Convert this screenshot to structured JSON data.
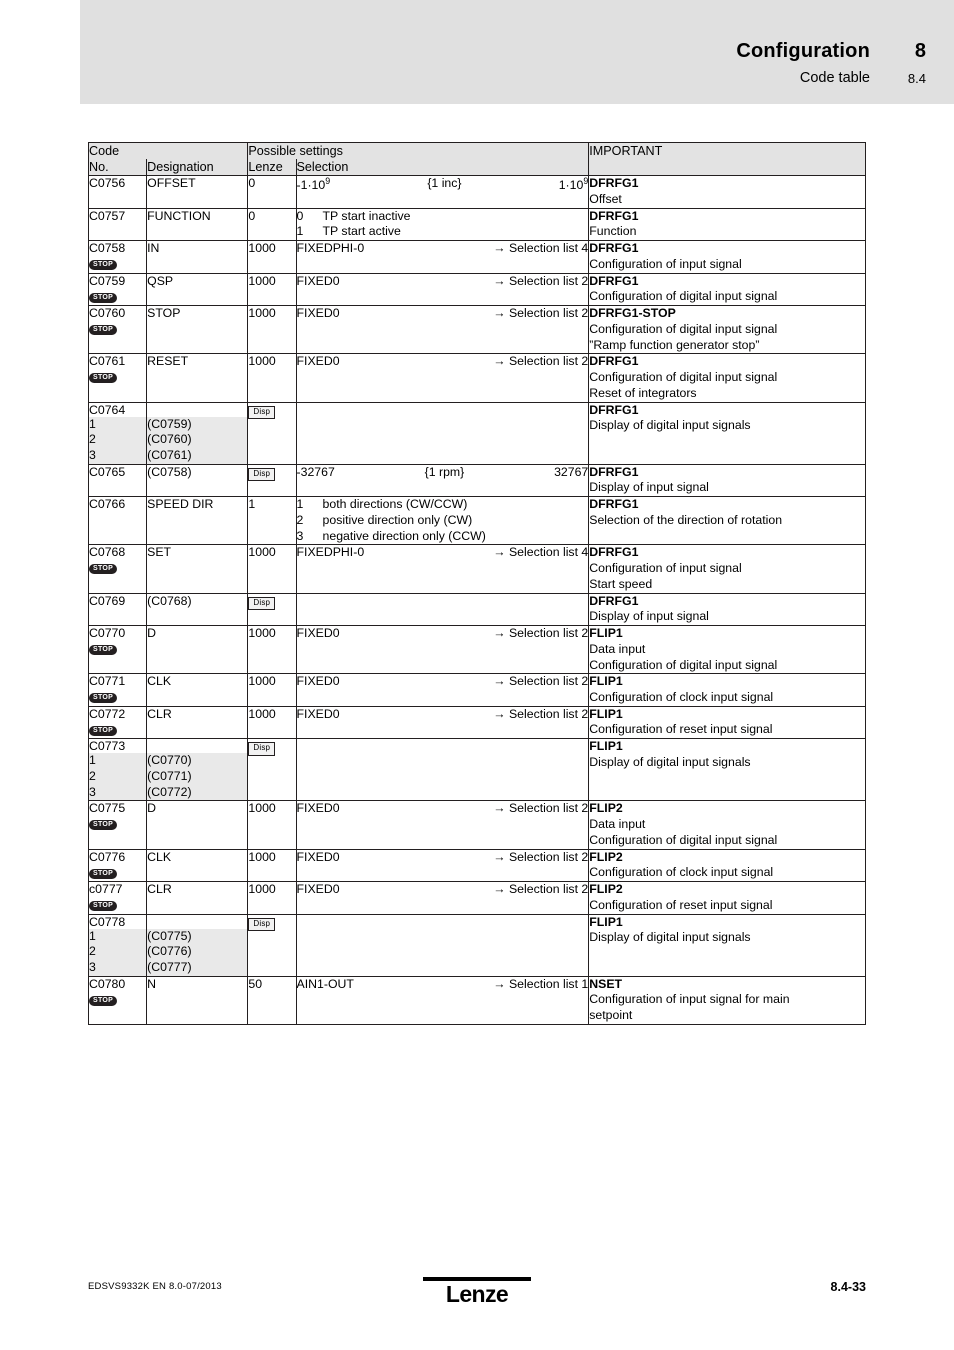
{
  "header": {
    "title": "Configuration",
    "subtitle": "Code table",
    "chapter_number": "8",
    "section_number": "8.4"
  },
  "table": {
    "header_row1": {
      "code": "Code",
      "possible_settings": "Possible settings",
      "important": "IMPORTANT"
    },
    "header_row2": {
      "no": "No.",
      "designation": "Designation",
      "lenze": "Lenze",
      "selection": "Selection"
    },
    "badges": {
      "stop": "STOP",
      "disp": "Disp"
    },
    "rows": [
      {
        "code": "C0756",
        "stop": false,
        "designation": "OFFSET",
        "lenze": "0",
        "selection_left": "-1·10",
        "selection_left_sup": "9",
        "selection_mid": "{1 inc}",
        "selection_right": "1·10",
        "selection_right_sup": "9",
        "important": [
          "DFRFG1",
          "Offset"
        ]
      },
      {
        "code": "C0757",
        "stop": false,
        "designation": "FUNCTION",
        "lenze": "0",
        "options": [
          {
            "idx": "0",
            "text": "TP start inactive"
          },
          {
            "idx": "1",
            "text": "TP start active"
          }
        ],
        "important": [
          "DFRFG1",
          "Function"
        ]
      },
      {
        "code": "C0758",
        "stop": true,
        "designation": "IN",
        "lenze": "1000",
        "selection_left": "FIXEDPHI-0",
        "selection_arrow": "→ Selection list 4",
        "important": [
          "DFRFG1",
          "Configuration of input signal"
        ]
      },
      {
        "code": "C0759",
        "stop": true,
        "designation": "QSP",
        "lenze": "1000",
        "selection_left": "FIXED0",
        "selection_arrow": "→ Selection list 2",
        "important": [
          "DFRFG1",
          "Configuration of digital input signal"
        ]
      },
      {
        "code": "C0760",
        "stop": true,
        "designation": "STOP",
        "lenze": "1000",
        "selection_left": "FIXED0",
        "selection_arrow": "→ Selection list 2",
        "important": [
          "DFRFG1-STOP",
          "Configuration of digital input signal",
          "”Ramp function generator stop”"
        ]
      },
      {
        "code": "C0761",
        "stop": true,
        "designation": "RESET",
        "lenze": "1000",
        "selection_left": "FIXED0",
        "selection_arrow": "→ Selection list 2",
        "important": [
          "DFRFG1",
          "Configuration of digital input signal",
          "Reset of integrators"
        ]
      },
      {
        "code": "C0764",
        "stop": false,
        "designation": "",
        "lenze_badge": "Disp",
        "subrows": [
          {
            "idx": "1",
            "text": "(C0759)"
          },
          {
            "idx": "2",
            "text": "(C0760)"
          },
          {
            "idx": "3",
            "text": "(C0761)"
          }
        ],
        "important": [
          "DFRFG1",
          "Display of digital input signals"
        ]
      },
      {
        "code": "C0765",
        "stop": false,
        "designation": "(C0758)",
        "lenze_badge": "Disp",
        "selection_left": "-32767",
        "selection_mid": "{1 rpm}",
        "selection_right": "32767",
        "important": [
          "DFRFG1",
          "Display of input signal"
        ]
      },
      {
        "code": "C0766",
        "stop": false,
        "designation": "SPEED DIR",
        "lenze": "1",
        "options": [
          {
            "idx": "1",
            "text": "both directions (CW/CCW)"
          },
          {
            "idx": "2",
            "text": "positive direction only (CW)"
          },
          {
            "idx": "3",
            "text": "negative direction only (CCW)"
          }
        ],
        "important": [
          "DFRFG1",
          "Selection of the direction of rotation"
        ]
      },
      {
        "code": "C0768",
        "stop": true,
        "designation": "SET",
        "lenze": "1000",
        "selection_left": "FIXEDPHI-0",
        "selection_arrow": "→ Selection list 4",
        "important": [
          "DFRFG1",
          "Configuration of input signal",
          "Start speed"
        ]
      },
      {
        "code": "C0769",
        "stop": false,
        "designation": "(C0768)",
        "lenze_badge": "Disp",
        "important": [
          "DFRFG1",
          "Display of input signal"
        ]
      },
      {
        "code": "C0770",
        "stop": true,
        "designation": "D",
        "lenze": "1000",
        "selection_left": "FIXED0",
        "selection_arrow": "→ Selection list 2",
        "important": [
          "FLIP1",
          "Data input",
          "Configuration of digital input signal"
        ]
      },
      {
        "code": "C0771",
        "stop": true,
        "designation": "CLK",
        "lenze": "1000",
        "selection_left": "FIXED0",
        "selection_arrow": "→ Selection list 2",
        "important": [
          "FLIP1",
          "Configuration of clock input signal"
        ]
      },
      {
        "code": "C0772",
        "stop": true,
        "designation": "CLR",
        "lenze": "1000",
        "selection_left": "FIXED0",
        "selection_arrow": "→ Selection list 2",
        "important": [
          "FLIP1",
          "Configuration of reset input signal"
        ]
      },
      {
        "code": "C0773",
        "stop": false,
        "designation": "",
        "lenze_badge": "Disp",
        "subrows": [
          {
            "idx": "1",
            "text": "(C0770)"
          },
          {
            "idx": "2",
            "text": "(C0771)"
          },
          {
            "idx": "3",
            "text": "(C0772)"
          }
        ],
        "important": [
          "FLIP1",
          "Display of digital input signals"
        ]
      },
      {
        "code": "C0775",
        "stop": true,
        "designation": "D",
        "lenze": "1000",
        "selection_left": "FIXED0",
        "selection_arrow": "→ Selection list 2",
        "important": [
          "FLIP2",
          "Data input",
          "Configuration of digital input signal"
        ]
      },
      {
        "code": "C0776",
        "stop": true,
        "designation": "CLK",
        "lenze": "1000",
        "selection_left": "FIXED0",
        "selection_arrow": "→ Selection list 2",
        "important": [
          "FLIP2",
          "Configuration of clock input signal"
        ]
      },
      {
        "code": "c0777",
        "stop": true,
        "designation": "CLR",
        "lenze": "1000",
        "selection_left": "FIXED0",
        "selection_arrow": "→ Selection list 2",
        "important": [
          "FLIP2",
          "Configuration of reset input signal"
        ]
      },
      {
        "code": "C0778",
        "stop": false,
        "designation": "",
        "lenze_badge": "Disp",
        "subrows": [
          {
            "idx": "1",
            "text": "(C0775)"
          },
          {
            "idx": "2",
            "text": "(C0776)"
          },
          {
            "idx": "3",
            "text": "(C0777)"
          }
        ],
        "important": [
          "FLIP1",
          "Display of digital input signals"
        ]
      },
      {
        "code": "C0780",
        "stop": true,
        "designation": "N",
        "lenze": "50",
        "selection_left": "AIN1-OUT",
        "selection_arrow": "→ Selection list 1",
        "important": [
          "NSET",
          "Configuration of input signal for main",
          "setpoint"
        ]
      }
    ]
  },
  "footer": {
    "document_id": "EDSVS9332K  EN  8.0-07/2013",
    "page_number": "8.4-33",
    "logo_text": "Lenze"
  }
}
